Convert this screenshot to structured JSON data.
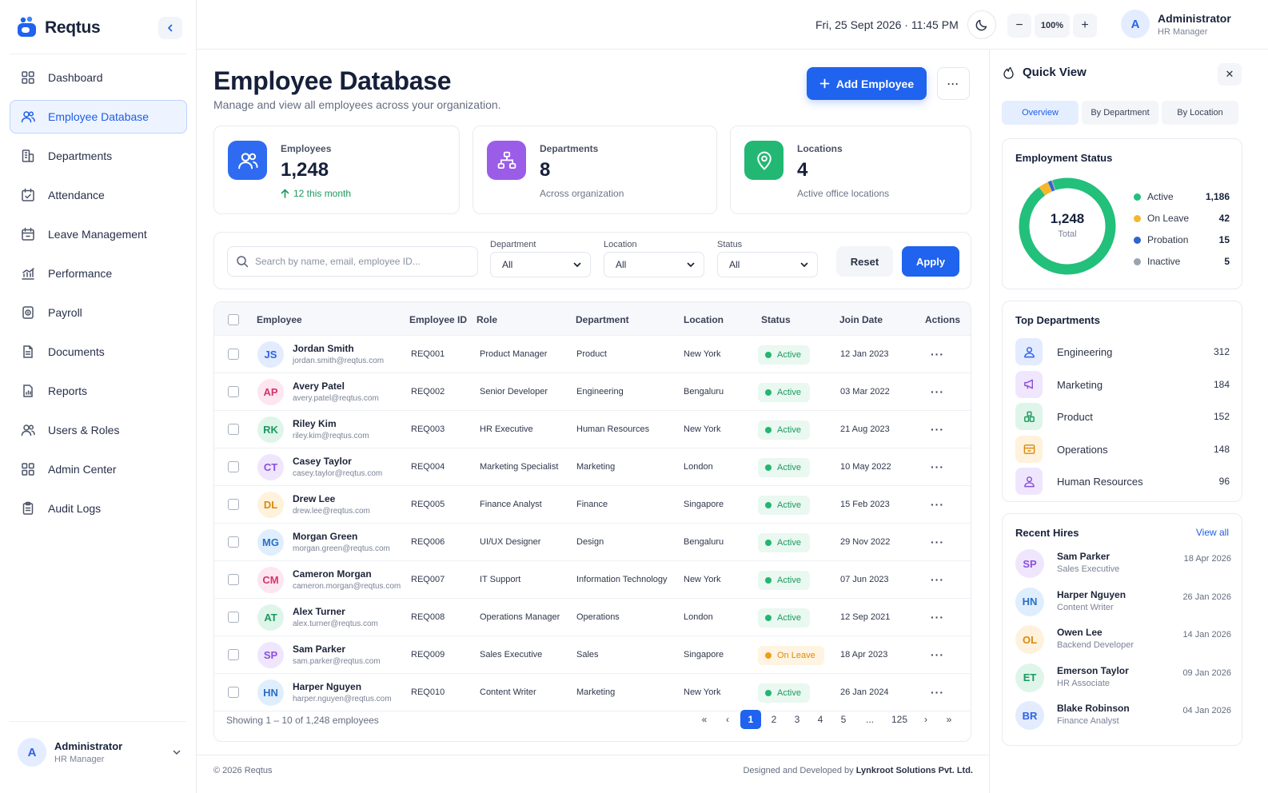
{
  "app": {
    "name": "Reqtus"
  },
  "sidebar": {
    "items": [
      {
        "label": "Dashboard",
        "icon": "grid-icon"
      },
      {
        "label": "Employee Database",
        "icon": "users-icon",
        "active": true
      },
      {
        "label": "Departments",
        "icon": "building-icon"
      },
      {
        "label": "Attendance",
        "icon": "calendar-check-icon"
      },
      {
        "label": "Leave Management",
        "icon": "calendar-leave-icon"
      },
      {
        "label": "Performance",
        "icon": "chart-icon"
      },
      {
        "label": "Payroll",
        "icon": "payroll-icon"
      },
      {
        "label": "Documents",
        "icon": "document-icon"
      },
      {
        "label": "Reports",
        "icon": "report-icon"
      },
      {
        "label": "Users & Roles",
        "icon": "user-roles-icon"
      },
      {
        "label": "Admin Center",
        "icon": "admin-grid-icon"
      },
      {
        "label": "Audit Logs",
        "icon": "clipboard-icon"
      }
    ],
    "user": {
      "initial": "A",
      "name": "Administrator",
      "role": "HR Manager"
    }
  },
  "topbar": {
    "datetime": "Fri, 25 Sept 2026 · 11:45 PM",
    "zoom": "100%",
    "zoom_out": "−",
    "zoom_in": "+",
    "user": {
      "initial": "A",
      "name": "Administrator",
      "role": "HR Manager"
    }
  },
  "page": {
    "title": "Employee Database",
    "subtitle": "Manage and view all employees across your organization.",
    "add_button": "Add Employee",
    "more_button": "···"
  },
  "stats": [
    {
      "label": "Employees",
      "value": "1,248",
      "note": "12 this month",
      "icon": "users-icon",
      "color": "#2f6bf0"
    },
    {
      "label": "Departments",
      "value": "8",
      "note": "Across organization",
      "icon": "sitemap-icon",
      "color": "#9b5de8"
    },
    {
      "label": "Locations",
      "value": "4",
      "note": "Active office locations",
      "icon": "map-pin-icon",
      "color": "#22b873"
    }
  ],
  "filters": {
    "search_placeholder": "Search by name, email, employee ID...",
    "department": {
      "label": "Department",
      "value": "All"
    },
    "location": {
      "label": "Location",
      "value": "All"
    },
    "status": {
      "label": "Status",
      "value": "All"
    },
    "reset": "Reset",
    "apply": "Apply"
  },
  "table": {
    "headers": {
      "employee": "Employee",
      "id": "Employee ID",
      "role": "Role",
      "department": "Department",
      "location": "Location",
      "status": "Status",
      "join": "Join Date",
      "actions": "Actions"
    },
    "rows": [
      {
        "initials": "JS",
        "name": "Jordan Smith",
        "email": "jordan.smith@reqtus.com",
        "id": "REQ001",
        "role": "Product Manager",
        "department": "Product",
        "location": "New York",
        "status": "Active",
        "join": "12 Jan 2023",
        "av_bg": "#e3ebff",
        "av_fg": "#2c62e6"
      },
      {
        "initials": "AP",
        "name": "Avery Patel",
        "email": "avery.patel@reqtus.com",
        "id": "REQ002",
        "role": "Senior Developer",
        "department": "Engineering",
        "location": "Bengaluru",
        "status": "Active",
        "join": "03 Mar 2022",
        "av_bg": "#fde6ef",
        "av_fg": "#d6336c"
      },
      {
        "initials": "RK",
        "name": "Riley Kim",
        "email": "riley.kim@reqtus.com",
        "id": "REQ003",
        "role": "HR Executive",
        "department": "Human Resources",
        "location": "New York",
        "status": "Active",
        "join": "21 Aug 2023",
        "av_bg": "#dff5ea",
        "av_fg": "#1b9a5f"
      },
      {
        "initials": "CT",
        "name": "Casey Taylor",
        "email": "casey.taylor@reqtus.com",
        "id": "REQ004",
        "role": "Marketing Specialist",
        "department": "Marketing",
        "location": "London",
        "status": "Active",
        "join": "10 May 2022",
        "av_bg": "#efe6fd",
        "av_fg": "#8a4fdc"
      },
      {
        "initials": "DL",
        "name": "Drew Lee",
        "email": "drew.lee@reqtus.com",
        "id": "REQ005",
        "role": "Finance Analyst",
        "department": "Finance",
        "location": "Singapore",
        "status": "Active",
        "join": "15 Feb 2023",
        "av_bg": "#fff2dc",
        "av_fg": "#d9890d"
      },
      {
        "initials": "MG",
        "name": "Morgan Green",
        "email": "morgan.green@reqtus.com",
        "id": "REQ006",
        "role": "UI/UX Designer",
        "department": "Design",
        "location": "Bengaluru",
        "status": "Active",
        "join": "29 Nov 2022",
        "av_bg": "#dfeefd",
        "av_fg": "#2a6fc9"
      },
      {
        "initials": "CM",
        "name": "Cameron Morgan",
        "email": "cameron.morgan@reqtus.com",
        "id": "REQ007",
        "role": "IT Support",
        "department": "Information Technology",
        "location": "New York",
        "status": "Active",
        "join": "07 Jun 2023",
        "av_bg": "#fde6ef",
        "av_fg": "#d6336c"
      },
      {
        "initials": "AT",
        "name": "Alex Turner",
        "email": "alex.turner@reqtus.com",
        "id": "REQ008",
        "role": "Operations Manager",
        "department": "Operations",
        "location": "London",
        "status": "Active",
        "join": "12 Sep 2021",
        "av_bg": "#dff5ea",
        "av_fg": "#1b9a5f"
      },
      {
        "initials": "SP",
        "name": "Sam Parker",
        "email": "sam.parker@reqtus.com",
        "id": "REQ009",
        "role": "Sales Executive",
        "department": "Sales",
        "location": "Singapore",
        "status": "On Leave",
        "join": "18 Apr 2023",
        "av_bg": "#efe6fd",
        "av_fg": "#8a4fdc"
      },
      {
        "initials": "HN",
        "name": "Harper Nguyen",
        "email": "harper.nguyen@reqtus.com",
        "id": "REQ010",
        "role": "Content Writer",
        "department": "Marketing",
        "location": "New York",
        "status": "Active",
        "join": "26 Jan 2024",
        "av_bg": "#dfeefd",
        "av_fg": "#2a6fc9"
      }
    ],
    "showing": "Showing 1 – 10 of 1,248 employees",
    "pagination": [
      "«",
      "‹",
      "1",
      "2",
      "3",
      "4",
      "5",
      "...",
      "125",
      "›",
      "»"
    ],
    "current_page": "1"
  },
  "footer": {
    "copyright": "© 2026 Reqtus",
    "credit_prefix": "Designed and Developed by",
    "credit_company": "Lynkroot Solutions Pvt. Ltd."
  },
  "quick_view": {
    "title": "Quick View",
    "close": "✕",
    "tabs": [
      "Overview",
      "By Department",
      "By Location"
    ],
    "employment_status": {
      "title": "Employment Status",
      "total_value": "1,248",
      "total_label": "Total",
      "items": [
        {
          "label": "Active",
          "value": 1186,
          "display": "1,186",
          "color": "#22c07a"
        },
        {
          "label": "On Leave",
          "value": 42,
          "display": "42",
          "color": "#f4b72c"
        },
        {
          "label": "Probation",
          "value": 15,
          "display": "15",
          "color": "#2f63d6"
        },
        {
          "label": "Inactive",
          "value": 5,
          "display": "5",
          "color": "#9aa3b2"
        }
      ]
    },
    "top_departments": {
      "title": "Top Departments",
      "items": [
        {
          "name": "Engineering",
          "count": "312",
          "icon": "engineering-icon",
          "bg": "#e3ebff",
          "fg": "#2c62e6"
        },
        {
          "name": "Marketing",
          "count": "184",
          "icon": "megaphone-icon",
          "bg": "#f0e6fd",
          "fg": "#8a4fdc"
        },
        {
          "name": "Product",
          "count": "152",
          "icon": "product-icon",
          "bg": "#dff5ea",
          "fg": "#1b9a5f"
        },
        {
          "name": "Operations",
          "count": "148",
          "icon": "operations-icon",
          "bg": "#fff2dc",
          "fg": "#d9890d"
        },
        {
          "name": "Human Resources",
          "count": "96",
          "icon": "hr-icon",
          "bg": "#efe6fd",
          "fg": "#8a4fdc"
        }
      ]
    },
    "recent_hires": {
      "title": "Recent Hires",
      "view_all": "View all",
      "items": [
        {
          "initials": "SP",
          "name": "Sam Parker",
          "role": "Sales Executive",
          "date": "18 Apr 2026",
          "bg": "#efe6fd",
          "fg": "#8a4fdc"
        },
        {
          "initials": "HN",
          "name": "Harper Nguyen",
          "role": "Content Writer",
          "date": "26 Jan 2026",
          "bg": "#dfeefd",
          "fg": "#2a6fc9"
        },
        {
          "initials": "OL",
          "name": "Owen Lee",
          "role": "Backend Developer",
          "date": "14 Jan 2026",
          "bg": "#fff2dc",
          "fg": "#d9890d"
        },
        {
          "initials": "ET",
          "name": "Emerson Taylor",
          "role": "HR Associate",
          "date": "09 Jan 2026",
          "bg": "#dff5ea",
          "fg": "#1b9a5f"
        },
        {
          "initials": "BR",
          "name": "Blake Robinson",
          "role": "Finance Analyst",
          "date": "04 Jan 2026",
          "bg": "#e3ebff",
          "fg": "#2c62e6"
        }
      ]
    }
  }
}
